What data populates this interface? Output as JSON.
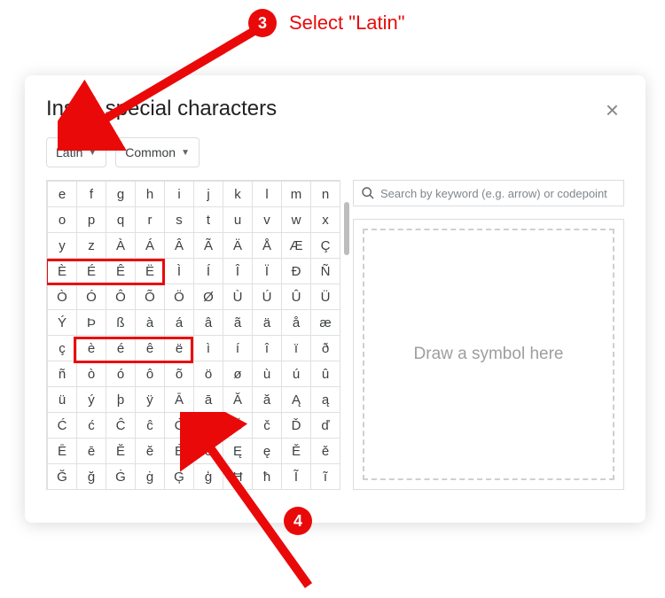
{
  "annotations": {
    "step3_number": "3",
    "step3_text": "Select \"Latin\"",
    "step4_number": "4"
  },
  "dialog": {
    "title": "Insert special characters",
    "close_label": "×",
    "dropdown_category": "Latin",
    "dropdown_subset": "Common"
  },
  "search": {
    "placeholder": "Search by keyword (e.g. arrow) or codepoint"
  },
  "draw": {
    "placeholder": "Draw a symbol here"
  },
  "grid": [
    [
      "e",
      "f",
      "g",
      "h",
      "i",
      "j",
      "k",
      "l",
      "m",
      "n"
    ],
    [
      "o",
      "p",
      "q",
      "r",
      "s",
      "t",
      "u",
      "v",
      "w",
      "x"
    ],
    [
      "y",
      "z",
      "À",
      "Á",
      "Â",
      "Ã",
      "Ä",
      "Å",
      "Æ",
      "Ç"
    ],
    [
      "È",
      "É",
      "Ê",
      "Ë",
      "Ì",
      "Í",
      "Î",
      "Ï",
      "Đ",
      "Ñ"
    ],
    [
      "Ò",
      "Ó",
      "Ô",
      "Õ",
      "Ö",
      "Ø",
      "Ù",
      "Ú",
      "Û",
      "Ü"
    ],
    [
      "Ý",
      "Þ",
      "ß",
      "à",
      "á",
      "â",
      "ã",
      "ä",
      "å",
      "æ"
    ],
    [
      "ç",
      "è",
      "é",
      "ê",
      "ë",
      "ì",
      "í",
      "î",
      "ï",
      "ð"
    ],
    [
      "ñ",
      "ò",
      "ó",
      "ô",
      "õ",
      "ö",
      "ø",
      "ù",
      "ú",
      "û"
    ],
    [
      "ü",
      "ý",
      "þ",
      "ÿ",
      "Ā",
      "ā",
      "Ă",
      "ă",
      "Ą",
      "ą"
    ],
    [
      "Ć",
      "ć",
      "Ĉ",
      "ĉ",
      "Ċ",
      "ċ",
      "Č",
      "č",
      "Ď",
      "ď"
    ],
    [
      "Ē",
      "ē",
      "Ĕ",
      "ĕ",
      "Ė",
      "ė",
      "Ę",
      "ę",
      "Ě",
      "ě"
    ],
    [
      "Ğ",
      "ğ",
      "Ġ",
      "ġ",
      "Ģ",
      "ģ",
      "Ħ",
      "ħ",
      "Ĩ",
      "ĩ"
    ]
  ]
}
